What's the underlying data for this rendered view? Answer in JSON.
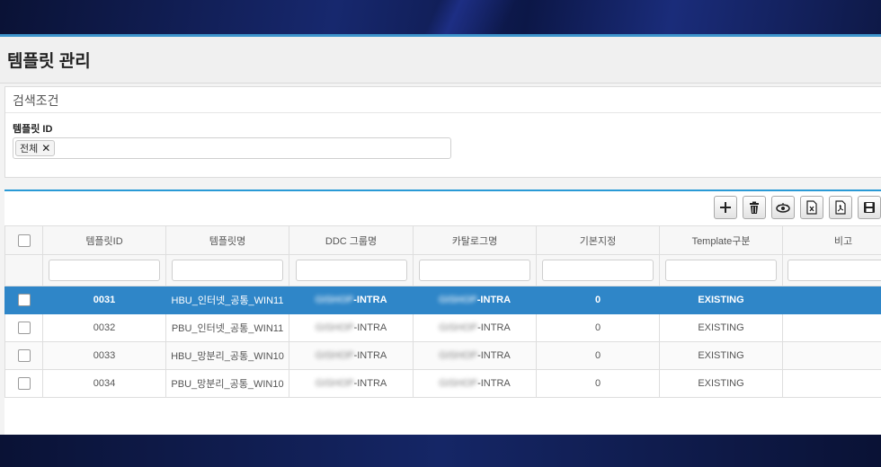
{
  "page": {
    "title": "템플릿 관리"
  },
  "search": {
    "header": "검색조건",
    "field_label": "템플릿 ID",
    "tag_value": "전체",
    "tag_remove": "✕"
  },
  "toolbar": {
    "buttons": [
      {
        "icon": "plus-icon"
      },
      {
        "icon": "trash-icon"
      },
      {
        "icon": "view-icon"
      },
      {
        "icon": "excel-export-icon"
      },
      {
        "icon": "pdf-export-icon"
      },
      {
        "icon": "save-icon"
      }
    ]
  },
  "grid": {
    "columns": [
      "템플릿ID",
      "템플릿명",
      "DDC 그룹명",
      "카탈로그명",
      "기본지정",
      "Template구분",
      "비고"
    ],
    "rows": [
      {
        "id": "0031",
        "name": "HBU_인터넷_공통_WIN11",
        "ddc_prefix": "GISHOP",
        "ddc_suffix": "-INTRA",
        "catalog_prefix": "GISHOP",
        "catalog_suffix": "-INTRA",
        "default": "0",
        "type": "EXISTING",
        "note": "",
        "selected": true
      },
      {
        "id": "0032",
        "name": "PBU_인터넷_공통_WIN11",
        "ddc_prefix": "GISHOP",
        "ddc_suffix": "-INTRA",
        "catalog_prefix": "GISHOP",
        "catalog_suffix": "-INTRA",
        "default": "0",
        "type": "EXISTING",
        "note": "",
        "selected": false
      },
      {
        "id": "0033",
        "name": "HBU_망분리_공통_WIN10",
        "ddc_prefix": "GISHOP",
        "ddc_suffix": "-INTRA",
        "catalog_prefix": "GISHOP",
        "catalog_suffix": "-INTRA",
        "default": "0",
        "type": "EXISTING",
        "note": "",
        "selected": false
      },
      {
        "id": "0034",
        "name": "PBU_망분리_공통_WIN10",
        "ddc_prefix": "GISHOP",
        "ddc_suffix": "-INTRA",
        "catalog_prefix": "GISHOP",
        "catalog_suffix": "-INTRA",
        "default": "0",
        "type": "EXISTING",
        "note": "",
        "selected": false
      }
    ]
  },
  "colors": {
    "accent": "#2a9ad6",
    "selected_row": "#2f86c8"
  }
}
